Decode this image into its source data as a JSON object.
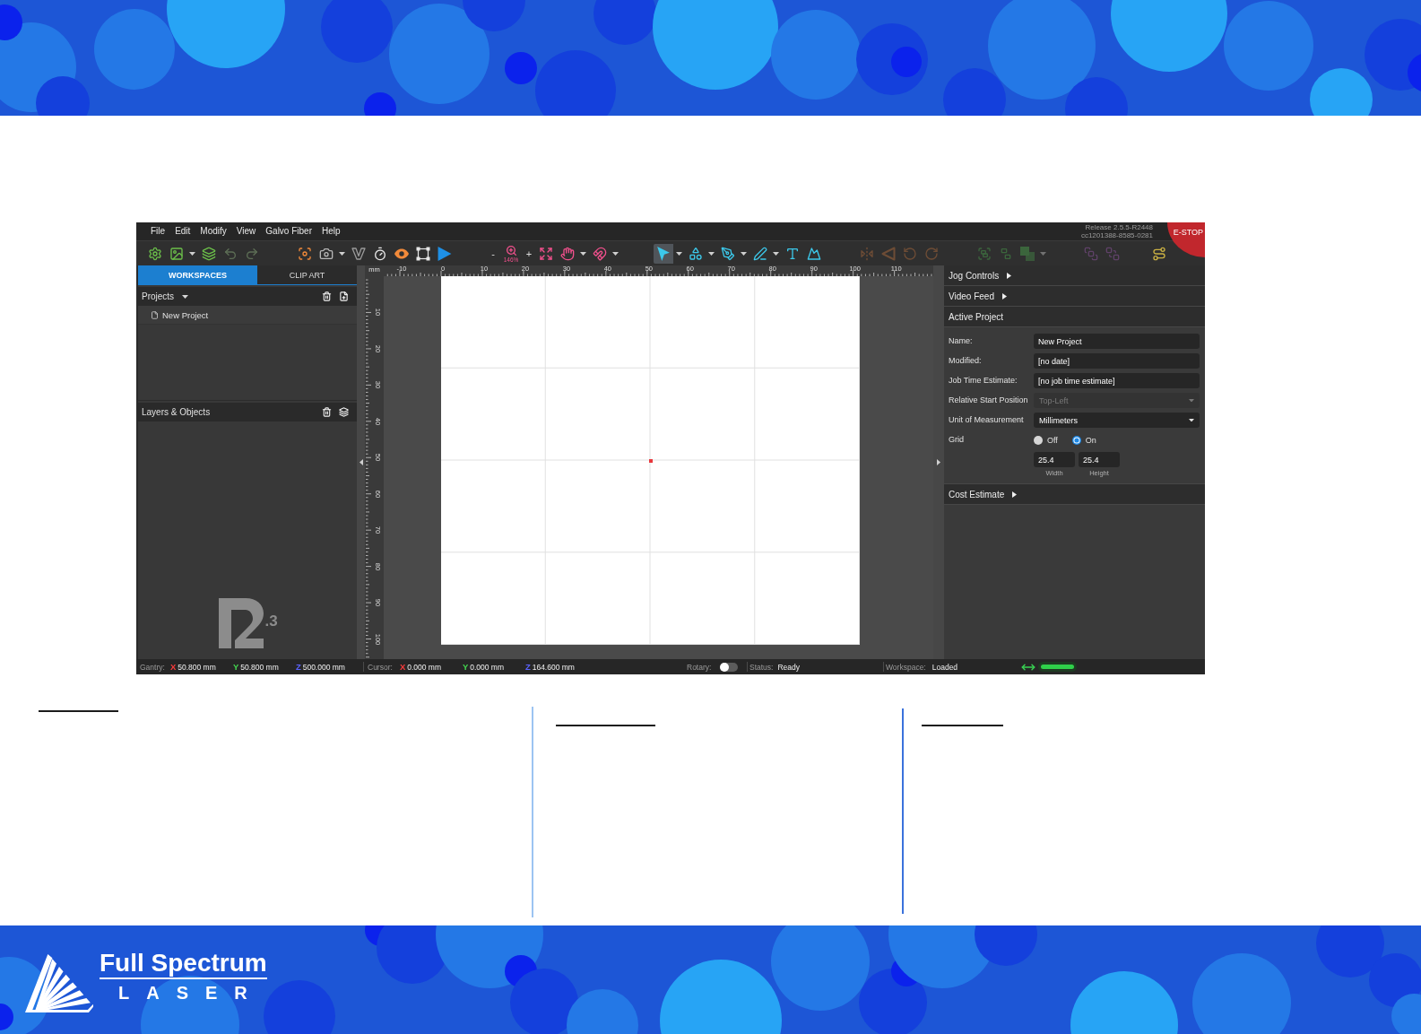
{
  "app": {
    "menu": [
      "File",
      "Edit",
      "Modify",
      "View",
      "Galvo Fiber",
      "Help"
    ],
    "version_lines": [
      "Release 2.5.5-R2448",
      "cc1201388-8585-0281"
    ],
    "estop": "E-STOP",
    "toolbar": {
      "groups": [
        {
          "tools": [
            {
              "kind": "tool",
              "selected": false,
              "disabled": false,
              "dropdown": false
            },
            {
              "kind": "tool",
              "selected": false,
              "disabled": false,
              "dropdown": true
            },
            {
              "kind": "tool",
              "selected": false,
              "disabled": false,
              "dropdown": false
            },
            {
              "kind": "tool",
              "selected": false,
              "disabled": true,
              "dropdown": false
            },
            {
              "kind": "tool",
              "selected": false,
              "disabled": true,
              "dropdown": false
            }
          ]
        },
        {
          "tools": [
            {
              "kind": "tool",
              "selected": false,
              "disabled": false,
              "dropdown": false
            },
            {
              "kind": "tool",
              "selected": false,
              "disabled": false,
              "dropdown": true
            },
            {
              "kind": "tool",
              "selected": false,
              "disabled": false,
              "dropdown": false
            },
            {
              "kind": "tool",
              "selected": false,
              "disabled": false,
              "dropdown": false
            },
            {
              "kind": "tool",
              "selected": false,
              "disabled": false,
              "dropdown": false
            },
            {
              "kind": "tool",
              "selected": false,
              "disabled": false,
              "dropdown": false
            },
            {
              "kind": "tool",
              "selected": false,
              "disabled": false,
              "dropdown": false
            }
          ]
        },
        {
          "tools": [
            {
              "kind": "zoom",
              "selected": false,
              "disabled": false,
              "minus": "-",
              "label": "146%",
              "plus": "+"
            },
            {
              "kind": "tool",
              "selected": false,
              "disabled": false,
              "dropdown": false
            },
            {
              "kind": "tool",
              "selected": false,
              "disabled": false,
              "dropdown": true
            },
            {
              "kind": "tool",
              "selected": false,
              "disabled": false,
              "dropdown": true
            }
          ]
        },
        {
          "tools": [
            {
              "kind": "tool",
              "selected": true,
              "disabled": false,
              "dropdown": true
            },
            {
              "kind": "tool",
              "selected": false,
              "disabled": false,
              "dropdown": true
            },
            {
              "kind": "tool",
              "selected": false,
              "disabled": false,
              "dropdown": true
            },
            {
              "kind": "tool",
              "selected": false,
              "disabled": false,
              "dropdown": true
            },
            {
              "kind": "tool",
              "selected": false,
              "disabled": false,
              "dropdown": false
            },
            {
              "kind": "tool",
              "selected": false,
              "disabled": false,
              "dropdown": false
            }
          ]
        },
        {
          "tools": [
            {
              "kind": "tool",
              "selected": false,
              "disabled": true,
              "dropdown": false
            },
            {
              "kind": "tool",
              "selected": false,
              "disabled": true,
              "dropdown": false
            },
            {
              "kind": "tool",
              "selected": false,
              "disabled": true,
              "dropdown": false
            },
            {
              "kind": "tool",
              "selected": false,
              "disabled": true,
              "dropdown": false
            }
          ]
        },
        {
          "tools": [
            {
              "kind": "tool",
              "selected": false,
              "disabled": true,
              "dropdown": false
            },
            {
              "kind": "tool",
              "selected": false,
              "disabled": true,
              "dropdown": false
            },
            {
              "kind": "tool",
              "selected": false,
              "disabled": true,
              "dropdown": true
            }
          ]
        },
        {
          "tools": [
            {
              "kind": "tool",
              "selected": false,
              "disabled": true,
              "dropdown": false
            },
            {
              "kind": "tool",
              "selected": false,
              "disabled": true,
              "dropdown": false
            }
          ]
        },
        {
          "tools": [
            {
              "kind": "tool",
              "selected": false,
              "disabled": false,
              "dropdown": false
            }
          ]
        }
      ]
    },
    "left_panel": {
      "tabs": [
        {
          "label": "WORKSPACES",
          "selected": true
        },
        {
          "label": "CLIP ART",
          "selected": false
        }
      ],
      "projects": {
        "title": "Projects",
        "items": [
          {
            "label": "New Project"
          }
        ]
      },
      "layers": {
        "title": "Layers & Objects"
      },
      "logo_suffix": ".3"
    },
    "rulers": {
      "unit": "mm",
      "x_labels": [
        "-10",
        "0",
        "10",
        "20",
        "30",
        "40",
        "50",
        "60",
        "70",
        "80",
        "90",
        "100",
        "110"
      ],
      "y_labels": [
        "10",
        "20",
        "30",
        "40",
        "50",
        "60",
        "70",
        "80",
        "90",
        "100"
      ]
    },
    "right_panel": {
      "sections": [
        {
          "title": "Jog Controls",
          "expanded": false
        },
        {
          "title": "Video Feed",
          "expanded": false
        },
        {
          "title": "Active Project",
          "expanded": true,
          "fields": [
            {
              "kind": "text",
              "label": "Name:",
              "value": "New Project"
            },
            {
              "kind": "text",
              "label": "Modified:",
              "value": "[no date]"
            },
            {
              "kind": "text",
              "label": "Job Time Estimate:",
              "value": "[no job time estimate]"
            },
            {
              "kind": "select",
              "label": "Relative Start Position",
              "value": "Top-Left",
              "disabled": true
            },
            {
              "kind": "select",
              "label": "Unit of Measurement",
              "value": "Millimeters",
              "disabled": false
            },
            {
              "kind": "radio",
              "label": "Grid",
              "options": [
                {
                  "label": "Off",
                  "selected": false
                },
                {
                  "label": "On",
                  "selected": true
                }
              ]
            },
            {
              "kind": "pair",
              "inputs": [
                {
                  "value": "25.4",
                  "caption": "Width"
                },
                {
                  "value": "25.4",
                  "caption": "Height"
                }
              ]
            }
          ]
        },
        {
          "title": "Cost Estimate",
          "expanded": false
        }
      ]
    },
    "status_bar": {
      "gantry": {
        "label": "Gantry:",
        "coords": [
          {
            "axis": "X",
            "value": "50.800 mm",
            "color": "#ff3b3b"
          },
          {
            "axis": "Y",
            "value": "50.800 mm",
            "color": "#43d64f"
          },
          {
            "axis": "Z",
            "value": "500.000 mm",
            "color": "#5b63ff"
          }
        ]
      },
      "cursor": {
        "label": "Cursor:",
        "coords": [
          {
            "axis": "X",
            "value": "0.000 mm",
            "color": "#ff3b3b"
          },
          {
            "axis": "Y",
            "value": "0.000 mm",
            "color": "#43d64f"
          },
          {
            "axis": "Z",
            "value": "164.600 mm",
            "color": "#5b63ff"
          }
        ]
      },
      "rotary": {
        "label": "Rotary:",
        "on": false
      },
      "status": {
        "label": "Status:",
        "value": "Ready"
      },
      "workspace": {
        "label": "Workspace:",
        "value": "Loaded"
      },
      "connection": {
        "level": 1
      }
    }
  },
  "brand": {
    "name": "Full Spectrum",
    "tagline": "LASER"
  }
}
